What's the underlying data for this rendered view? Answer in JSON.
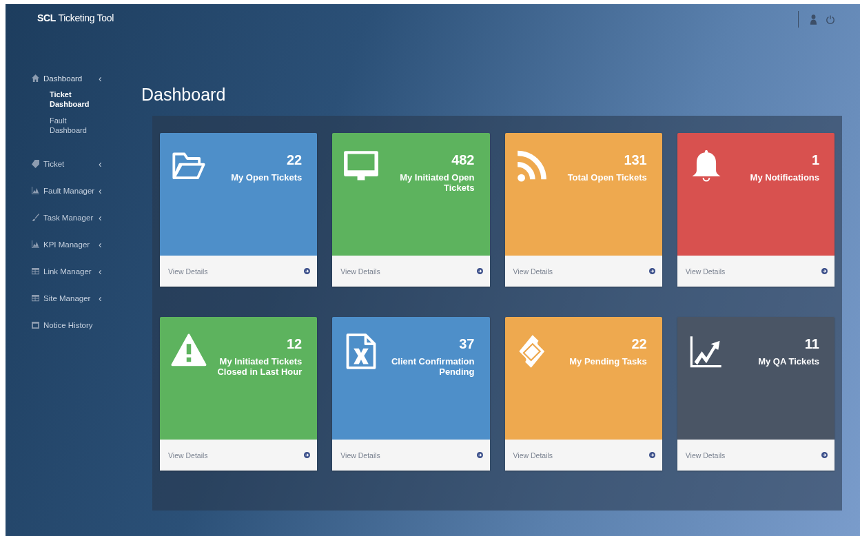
{
  "header": {
    "brand": "**SCL** Ticketing Tool"
  },
  "sidebar": {
    "items": [
      {
        "kind": "home",
        "label": "Dashboard",
        "caret": "‹",
        "expanded": true,
        "children": [
          {
            "label": "Ticket Dashboard",
            "selected": true
          },
          {
            "label": "Fault Dashboard",
            "selected": false
          }
        ]
      },
      {
        "kind": "tag",
        "label": "Ticket",
        "caret": "‹",
        "expanded": false
      },
      {
        "kind": "area",
        "label": "Fault Manager",
        "caret": "‹",
        "expanded": false
      },
      {
        "kind": "brush",
        "label": "Task Manager",
        "caret": "‹",
        "expanded": false
      },
      {
        "kind": "area",
        "label": "KPI Manager",
        "caret": "‹",
        "expanded": false
      },
      {
        "kind": "table",
        "label": "Link Manager",
        "caret": "‹",
        "expanded": false
      },
      {
        "kind": "table",
        "label": "Site Manager",
        "caret": "‹",
        "expanded": false
      },
      {
        "kind": "calendar",
        "label": "Notice History",
        "expanded": false
      }
    ]
  },
  "page_title": "Dashboard",
  "cards": [
    {
      "kind": "folder",
      "color": "#4e8fc9",
      "count": "22",
      "label": "My Open Tickets",
      "link": "View Details"
    },
    {
      "kind": "monitor",
      "color": "#5db35e",
      "count": "482",
      "label": "My Initiated Open Tickets",
      "link": "View Details"
    },
    {
      "kind": "rss",
      "color": "#eea94f",
      "count": "131",
      "label": "Total Open Tickets",
      "link": "View Details"
    },
    {
      "kind": "bell",
      "color": "#d8514f",
      "count": "1",
      "label": "My Notifications",
      "link": "View Details"
    },
    {
      "kind": "warning",
      "color": "#5db35e",
      "count": "12",
      "label": "My Initiated Tickets Closed in Last Hour",
      "link": "View Details"
    },
    {
      "kind": "spreadsheet",
      "color": "#4e8fc9",
      "count": "37",
      "label": "Client Confirmation Pending",
      "link": "View Details"
    },
    {
      "kind": "ticket",
      "color": "#eea94f",
      "count": "22",
      "label": "My Pending Tasks",
      "link": "View Details"
    },
    {
      "kind": "chart",
      "color": "#4a5565",
      "count": "11",
      "label": "My QA Tickets",
      "link": "View Details"
    }
  ]
}
